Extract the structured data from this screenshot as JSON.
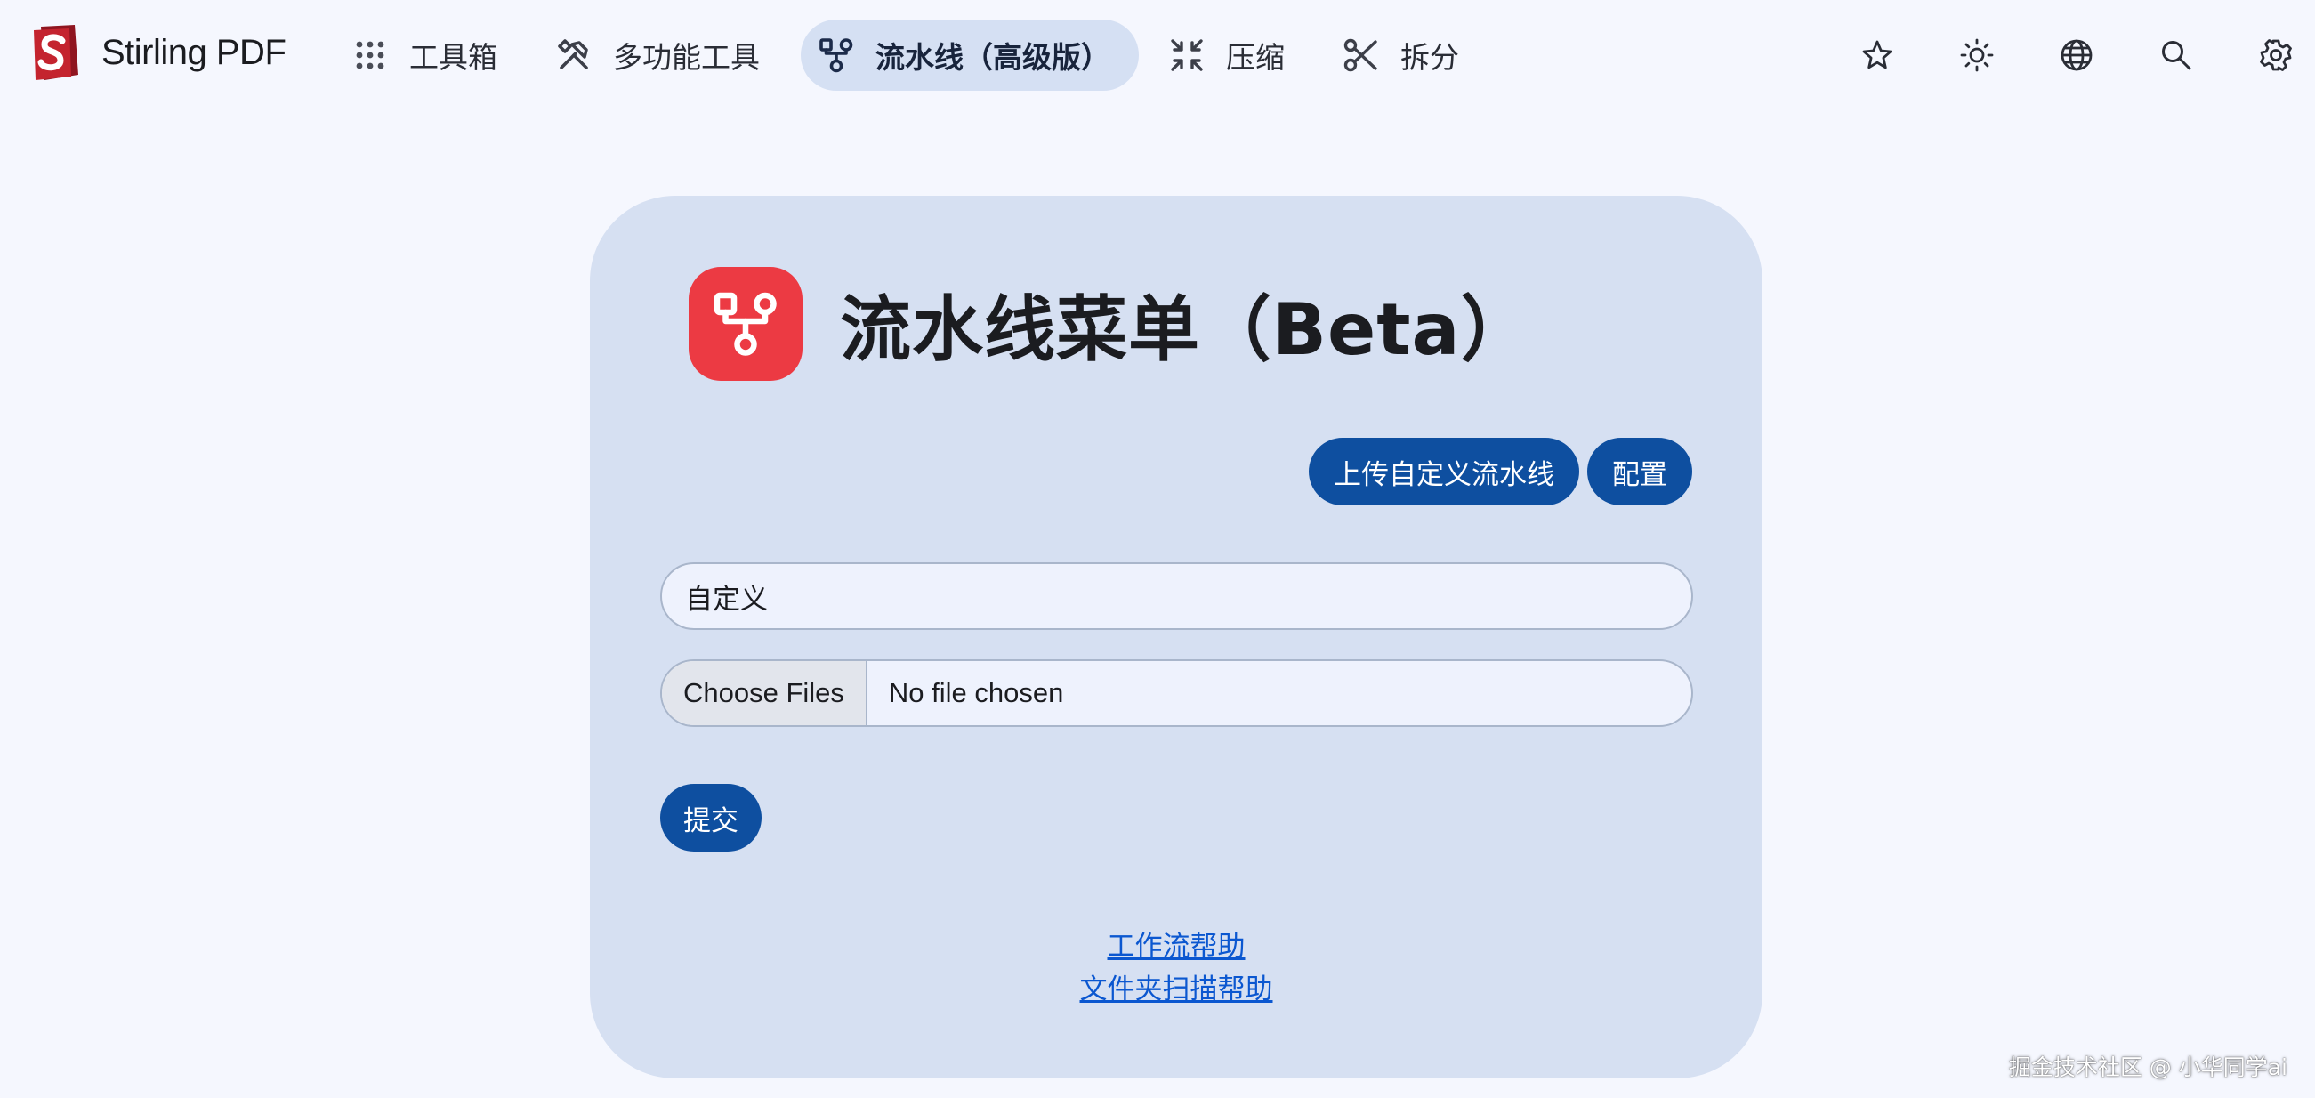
{
  "brand": {
    "name": "Stirling PDF",
    "logo_icon": "stirling-pdf-logo"
  },
  "nav": {
    "items": [
      {
        "label": "工具箱",
        "icon": "grid-dots-icon"
      },
      {
        "label": "多功能工具",
        "icon": "tools-icon"
      },
      {
        "label": "流水线（高级版）",
        "icon": "pipeline-icon",
        "active": true
      },
      {
        "label": "压缩",
        "icon": "compress-arrows-icon"
      },
      {
        "label": "拆分",
        "icon": "scissors-icon"
      }
    ]
  },
  "toolbar": {
    "icons": [
      "star-icon",
      "theme-sun-icon",
      "language-globe-icon",
      "search-icon",
      "settings-gear-icon"
    ]
  },
  "card": {
    "title": "流水线菜单（Beta）",
    "badge_icon": "pipeline-icon",
    "upload_button": "上传自定义流水线",
    "config_button": "配置",
    "pipeline_select_value": "自定义",
    "file_button": "Choose Files",
    "file_status": "No file chosen",
    "submit_button": "提交",
    "help_links": [
      "工作流帮助",
      "文件夹扫描帮助"
    ]
  },
  "watermark": "掘金技术社区 @ 小华同学ai",
  "colors": {
    "background": "#f5f7fe",
    "card": "#d6e0f2",
    "primary_button": "#0e4fa0",
    "nav_active": "#d5e0f3",
    "badge": "#ec3a43",
    "link": "#0b57d0"
  }
}
